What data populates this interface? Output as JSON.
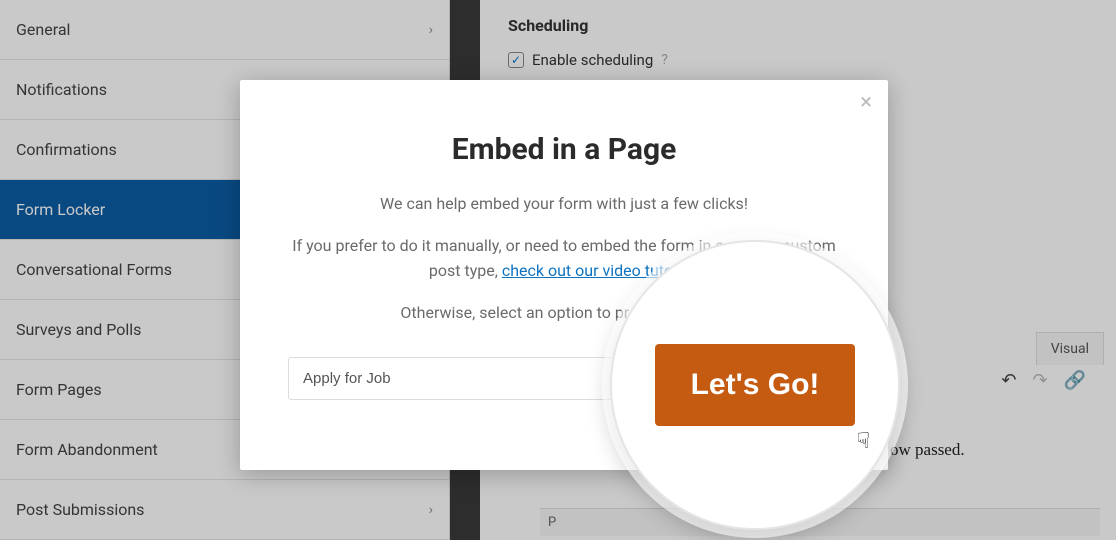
{
  "sidebar": {
    "items": [
      {
        "label": "General",
        "has_chevron": true
      },
      {
        "label": "Notifications",
        "has_chevron": false
      },
      {
        "label": "Confirmations",
        "has_chevron": false
      },
      {
        "label": "Form Locker",
        "has_chevron": false,
        "active": true
      },
      {
        "label": "Conversational Forms",
        "has_chevron": false
      },
      {
        "label": "Surveys and Polls",
        "has_chevron": false
      },
      {
        "label": "Form Pages",
        "has_chevron": false
      },
      {
        "label": "Form Abandonment",
        "has_chevron": true
      },
      {
        "label": "Post Submissions",
        "has_chevron": true
      }
    ]
  },
  "content": {
    "section_title": "Scheduling",
    "checkbox_label": "Enable scheduling",
    "tab_label": "Visual",
    "body_fragment": "ow passed.",
    "status_char": "P"
  },
  "modal": {
    "title": "Embed in a Page",
    "line1": "We can help embed your form with just a few clicks!",
    "line2a": "If you prefer to do it manually, or need to embed the form in a post or custom post type, ",
    "link_text": "check out our video tutorial",
    "line2b": ".",
    "line3": "Otherwise, select an option to proceed wizard.",
    "input_value": "Apply for Job",
    "button_label": "Let's Go!",
    "close_label": "×"
  }
}
